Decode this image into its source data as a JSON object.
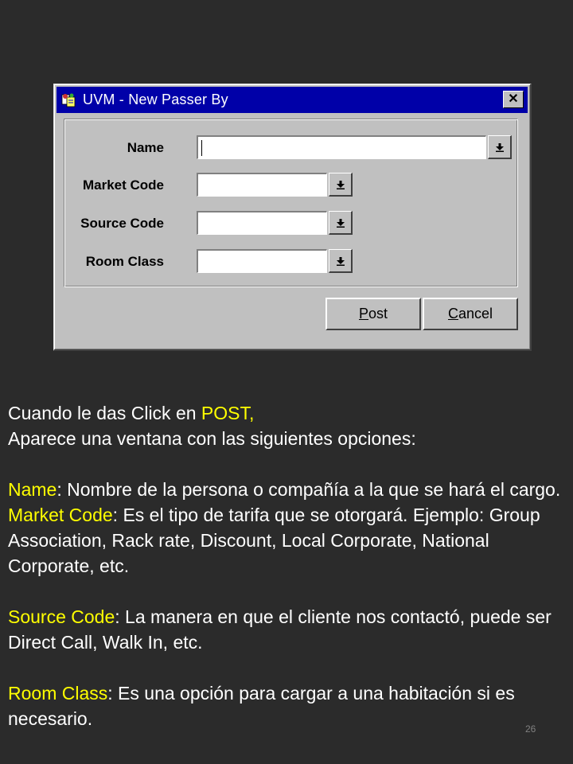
{
  "dialog": {
    "title": "UVM - New Passer By",
    "close_label": "✕",
    "fields": [
      {
        "label": "Name",
        "value": ""
      },
      {
        "label": "Market Code",
        "value": ""
      },
      {
        "label": "Source Code",
        "value": ""
      },
      {
        "label": "Room Class",
        "value": ""
      }
    ],
    "buttons": {
      "post": {
        "mnemonic": "P",
        "rest": "ost"
      },
      "cancel": {
        "mnemonic": "C",
        "rest": "ancel"
      }
    },
    "dropdown_icon": "dropdown-arrow-icon",
    "app_icon": "app-icon"
  },
  "description": {
    "intro_line1_prefix": "Cuando le das Click en ",
    "intro_line1_highlight": "POST,",
    "intro_line2": "Aparece una ventana con las siguientes opciones:",
    "items": [
      {
        "term": "Name",
        "text": ": Nombre de la persona o compañía a la que se hará el cargo."
      },
      {
        "term": "Market Code",
        "text": ": Es el tipo de tarifa que se otorgará. Ejemplo: Group Association, Rack rate, Discount, Local Corporate, National Corporate, etc."
      },
      {
        "term": "Source Code",
        "text": ": La manera en que el cliente nos contactó, puede ser Direct Call, Walk In, etc."
      },
      {
        "term": "Room Class",
        "text": ": Es una opción para cargar a una habitación si es necesario."
      }
    ]
  },
  "page_number": "26",
  "colors": {
    "background": "#2b2b2b",
    "titlebar": "#0000a8",
    "highlight": "#ffff00",
    "text": "#ffffff"
  }
}
